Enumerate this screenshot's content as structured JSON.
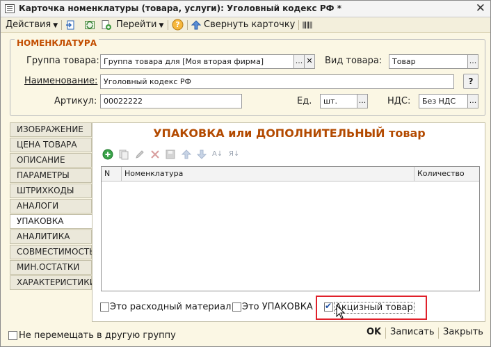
{
  "window": {
    "title": "Карточка номенклатуры (товара, услуги): Уголовный кодекс РФ *",
    "close_glyph": "✕"
  },
  "toolbar": {
    "actions_label": "Действия",
    "goto_label": "Перейти",
    "collapse_label": "Свернуть карточку",
    "help_glyph": "?"
  },
  "nomenclature": {
    "group_title": "НОМЕНКЛАТУРА",
    "group_label": "Группа товара:",
    "group_value": "Группа товара для [Моя вторая фирма]",
    "kind_label": "Вид товара:",
    "kind_value": "Товар",
    "name_label": "Наименование:",
    "name_value": "Уголовный кодекс РФ",
    "article_label": "Артикул:",
    "article_value": "00022222",
    "unit_label": "Ед.",
    "unit_value": "шт.",
    "vat_label": "НДС:",
    "vat_value": "Без НДС",
    "ellipsis": "...",
    "clear_glyph": "✕",
    "help_glyph": "?"
  },
  "tabs": [
    {
      "label": "ИЗОБРАЖЕНИЕ"
    },
    {
      "label": "ЦЕНА ТОВАРА"
    },
    {
      "label": "ОПИСАНИЕ"
    },
    {
      "label": "ПАРАМЕТРЫ"
    },
    {
      "label": "ШТРИХКОДЫ"
    },
    {
      "label": "АНАЛОГИ"
    },
    {
      "label": "УПАКОВКА"
    },
    {
      "label": "АНАЛИТИКА"
    },
    {
      "label": "СОВМЕСТИМОСТЬ"
    },
    {
      "label": "МИН.ОСТАТКИ"
    },
    {
      "label": "ХАРАКТЕРИСТИКИ"
    }
  ],
  "packaging": {
    "title": "УПАКОВКА или ДОПОЛНИТЕЛЬНЫЙ товар",
    "columns": [
      "N",
      "Номенклатура",
      "Количество"
    ],
    "sort_asc": "А↓",
    "sort_desc": "Я↓"
  },
  "options": {
    "consumable_label": "Это расходный материал",
    "is_package_label": "Это УПАКОВКА",
    "excise_label": "Акцизный товар",
    "excise_checked": true
  },
  "footer": {
    "no_move_label": "Не перемещать в другую группу",
    "ok_label": "OK",
    "save_label": "Записать",
    "close_label": "Закрыть"
  },
  "colors": {
    "window_bg": "#fbf7e4",
    "accent_orange": "#c24d00",
    "highlight_red": "#e0202a"
  }
}
